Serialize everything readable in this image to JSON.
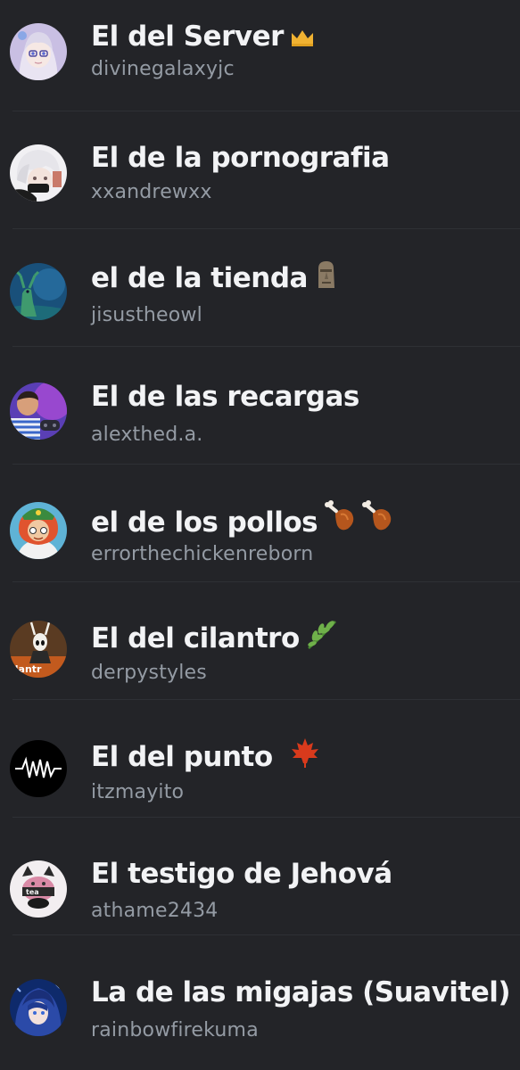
{
  "members": [
    {
      "nickname": "El del Server",
      "username": "divinegalaxyjc",
      "emoji_icons": [
        "crown-icon"
      ],
      "avatar_color": "#b7a9d8"
    },
    {
      "nickname": "El de la pornografia",
      "username": "xxandrewxx",
      "emoji_icons": [],
      "avatar_color": "#e8e6ea"
    },
    {
      "nickname": "el de la tienda",
      "username": "jisustheowl",
      "emoji_icons": [
        "moai-icon"
      ],
      "avatar_color": "#1d5c87"
    },
    {
      "nickname": "El de las recargas",
      "username": "alexthed.a.",
      "emoji_icons": [],
      "avatar_color": "#6b49c9"
    },
    {
      "nickname": "el de los pollos",
      "username": "errorthechickenreborn",
      "emoji_icons": [
        "poultry-leg-icon",
        "poultry-leg-icon"
      ],
      "avatar_color": "#4a9ec4"
    },
    {
      "nickname": "El del cilantro",
      "username": "derpystyles",
      "emoji_icons": [
        "herb-icon"
      ],
      "avatar_color": "#6b4a2e"
    },
    {
      "nickname": "El del punto",
      "username": "itzmayito",
      "emoji_icons": [
        "maple-leaf-icon"
      ],
      "avatar_color": "#000000"
    },
    {
      "nickname": "El testigo de Jehová",
      "username": "athame2434",
      "emoji_icons": [],
      "avatar_color": "#efe7ea"
    },
    {
      "nickname": "La de las migajas (Suavitel)",
      "username": "rainbowfirekuma",
      "emoji_icons": [],
      "avatar_color": "#2b3f8c"
    }
  ],
  "colors": {
    "background": "#232428",
    "divider": "#2e3035",
    "nickname_text": "#f2f3f5",
    "username_text": "#949ba4",
    "crown": "#f0b232"
  }
}
